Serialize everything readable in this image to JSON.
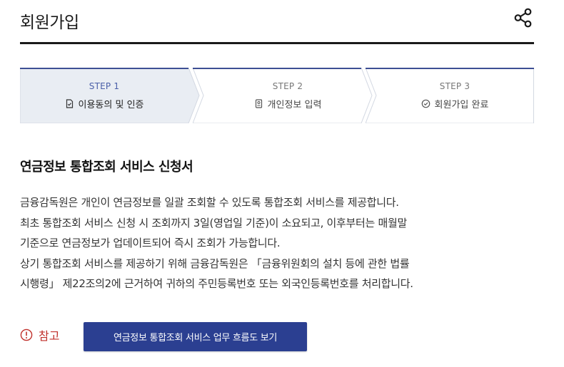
{
  "header": {
    "title": "회원가입",
    "share_icon": "share-icon"
  },
  "steps": [
    {
      "number": "STEP 1",
      "label": "이용동의 및 인증",
      "icon": "document-check-icon",
      "active": true
    },
    {
      "number": "STEP 2",
      "label": "개인정보 입력",
      "icon": "id-card-icon",
      "active": false
    },
    {
      "number": "STEP 3",
      "label": "회원가입 완료",
      "icon": "check-circle-icon",
      "active": false
    }
  ],
  "section": {
    "title": "연금정보 통합조회 서비스 신청서",
    "lines": [
      "금융감독원은 개인이 연금정보를 일괄 조회할 수 있도록 통합조회 서비스를 제공합니다.",
      "최초 통합조회 서비스 신청 시 조회까지 3일(영업일 기준)이 소요되고, 이후부터는 매월말",
      "기준으로 연금정보가 업데이트되어 즉시 조회가 가능합니다.",
      "상기 통합조회 서비스를 제공하기 위해 금융감독원은 「금융위원회의 설치 등에 관한 법률",
      "시행령」 제22조의2에 근거하여 귀하의 주민등록번호 또는 외국인등록번호를 처리합니다."
    ]
  },
  "note": {
    "label": "참고",
    "icon": "info-circle-icon",
    "button_label": "연금정보 통합조회 서비스 업무 흐름도 보기"
  },
  "colors": {
    "accent": "#2b3f91",
    "active_step_bg": "#e9edf3",
    "alert": "#c0302b"
  }
}
